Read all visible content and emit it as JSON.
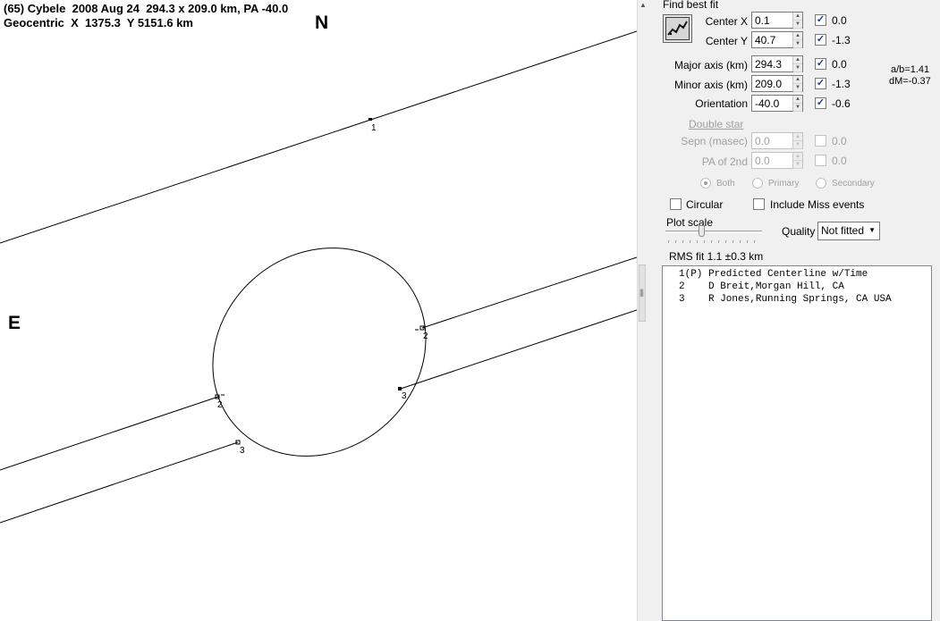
{
  "plot": {
    "title_line1": "(65) Cybele  2008 Aug 24  294.3 x 209.0 km, PA -40.0",
    "title_line2": "Geocentric  X  1375.3  Y 5151.6 km",
    "north_label": "N",
    "east_label": "E",
    "chord_labels": {
      "line1": "1",
      "c2_start": "2",
      "c2_end": "2",
      "c3_start": "3",
      "c3_end": "3"
    }
  },
  "panel": {
    "find_best_fit_label": "Find best fit",
    "fit_button_icon": "chart-icon",
    "center_x": {
      "label": "Center X",
      "value": "0.1",
      "checked": true,
      "fit": "0.0"
    },
    "center_y": {
      "label": "Center Y",
      "value": "40.7",
      "checked": true,
      "fit": "-1.3"
    },
    "major_axis": {
      "label": "Major axis (km)",
      "value": "294.3",
      "checked": true,
      "fit": "0.0"
    },
    "minor_axis": {
      "label": "Minor axis (km)",
      "value": "209.0",
      "checked": true,
      "fit": "-1.3"
    },
    "orientation": {
      "label": "Orientation",
      "value": "-40.0",
      "checked": true,
      "fit": "-0.6"
    },
    "ab_ratio": "a/b=1.41",
    "dm": "dM=-0.37",
    "double_star": {
      "heading": "Double star",
      "sepn": {
        "label": "Sepn (masec)",
        "value": "0.0",
        "checked": false,
        "fit": "0.0"
      },
      "pa2nd": {
        "label": "PA of 2nd",
        "value": "0.0",
        "checked": false,
        "fit": "0.0"
      },
      "radios": [
        "Both",
        "Primary",
        "Secondary"
      ],
      "selected": "Both"
    },
    "circular": {
      "label": "Circular",
      "checked": false
    },
    "include_miss": {
      "label": "Include Miss events",
      "checked": false
    },
    "plot_scale_label": "Plot scale",
    "quality_label": "Quality",
    "quality_value": "Not fitted",
    "rms_fit": "RMS fit 1.1 ±0.3 km",
    "observers": [
      "1(P) Predicted Centerline w/Time",
      "2    D Breit,Morgan Hill, CA",
      "3    R Jones,Running Springs, CA USA"
    ]
  }
}
